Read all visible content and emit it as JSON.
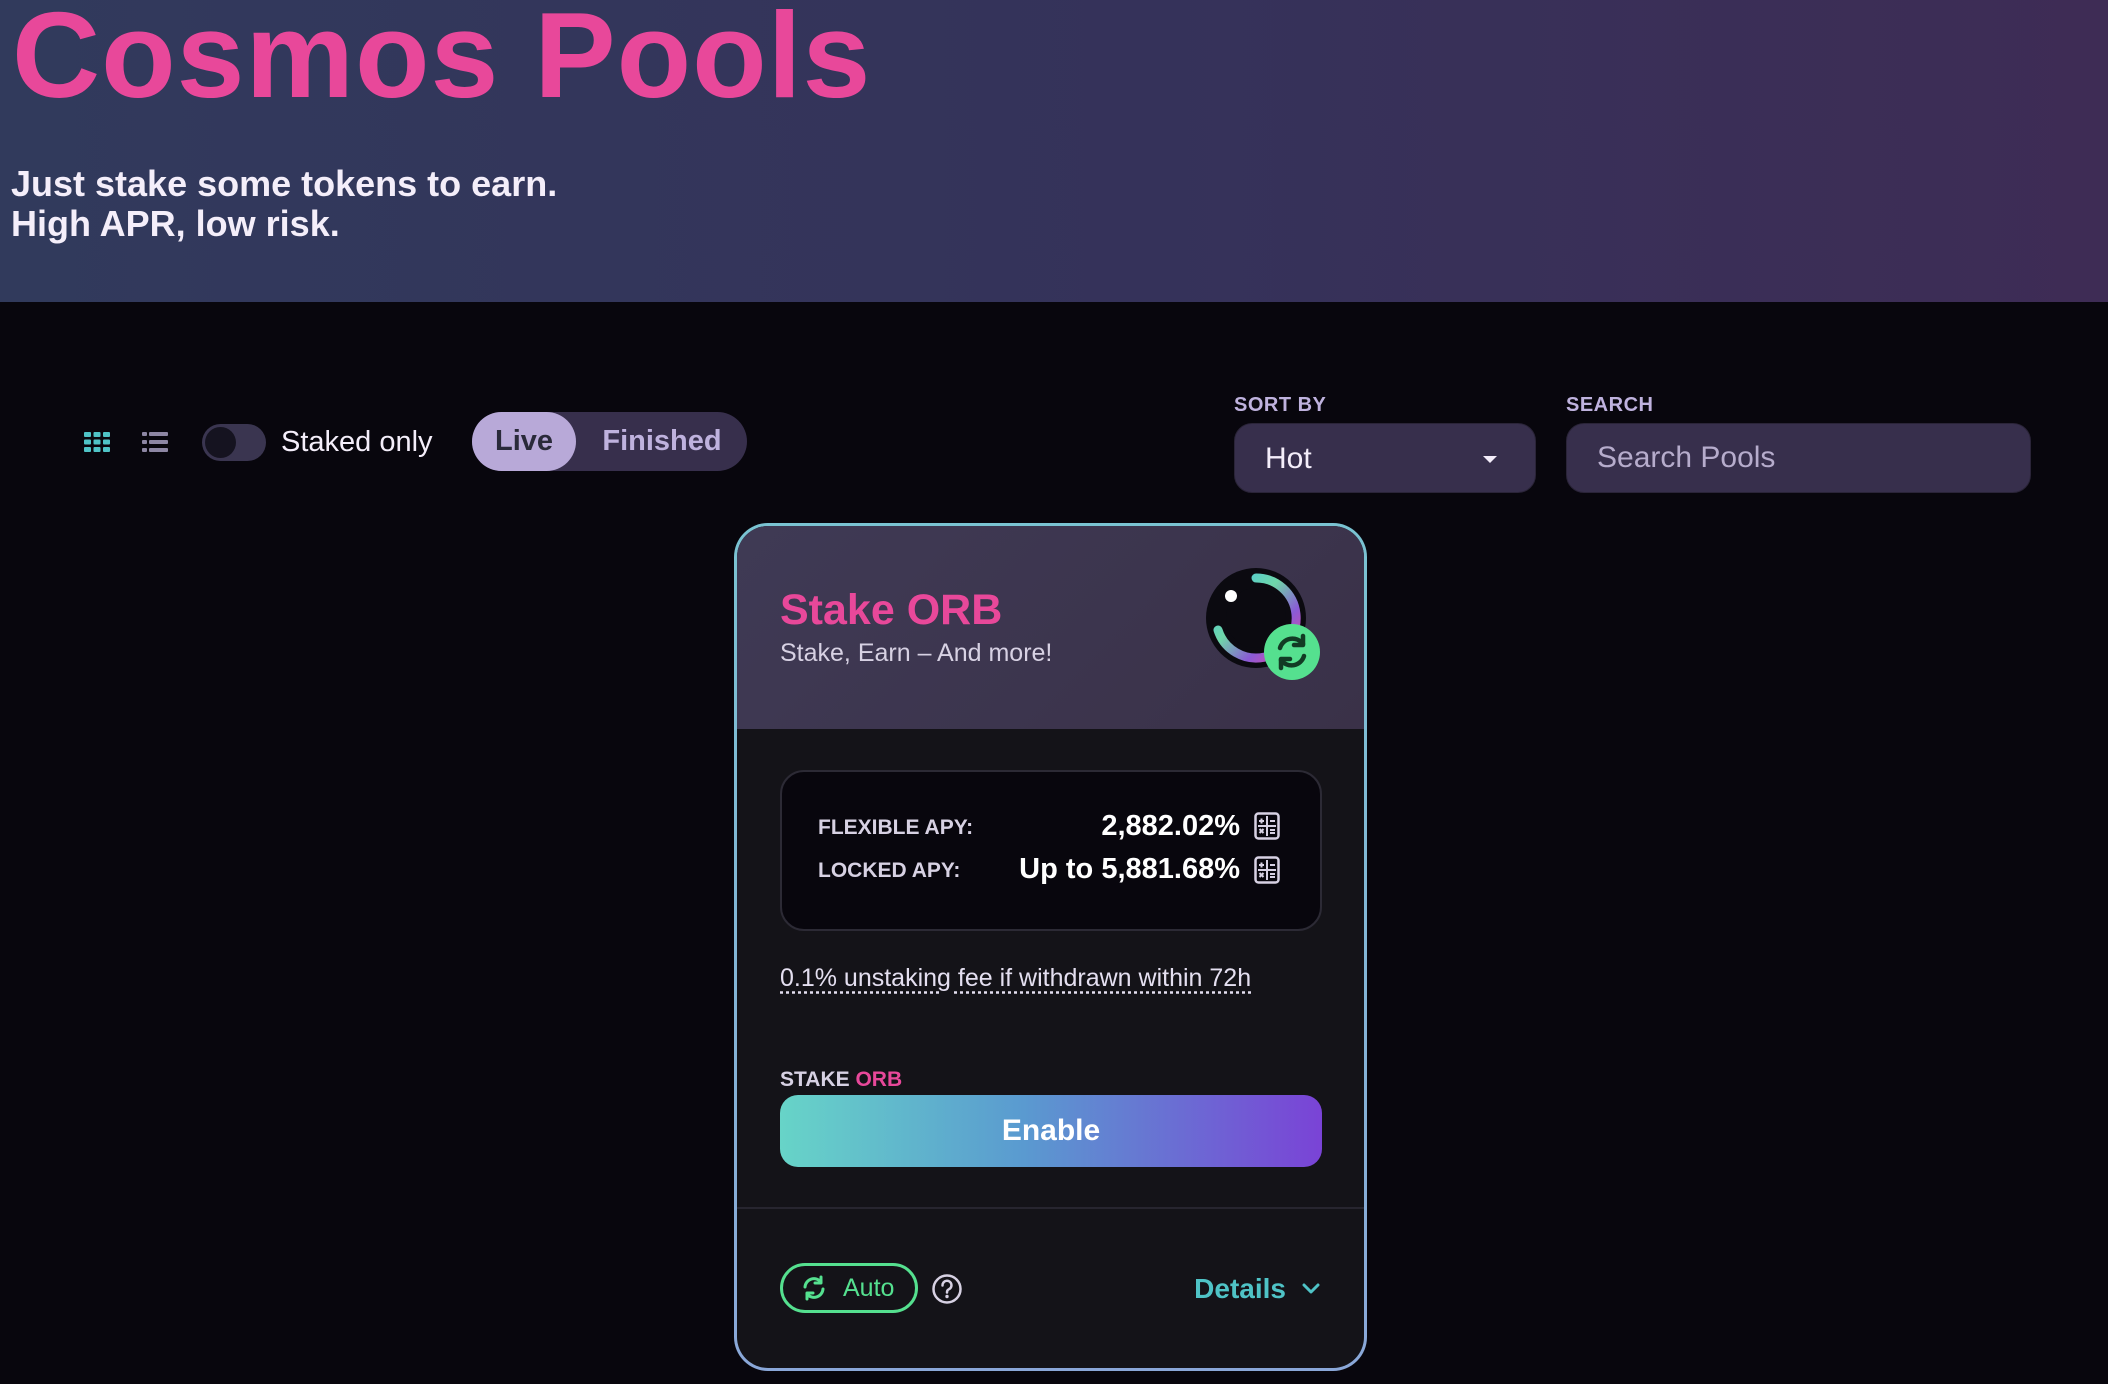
{
  "header": {
    "title": "Cosmos Pools",
    "subtitle_line1": "Just stake some tokens to earn.",
    "subtitle_line2": "High APR, low risk."
  },
  "toolbar": {
    "staked_only_label": "Staked only",
    "staked_only_on": false,
    "tabs": [
      {
        "label": "Live",
        "active": true
      },
      {
        "label": "Finished",
        "active": false
      }
    ],
    "sort_label": "SORT BY",
    "sort_value": "Hot",
    "search_label": "SEARCH",
    "search_placeholder": "Search Pools"
  },
  "pool_card": {
    "title": "Stake ORB",
    "subtitle": "Stake, Earn – And more!",
    "flexible_apy_label": "FLEXIBLE APY:",
    "flexible_apy_value": "2,882.02%",
    "locked_apy_label": "LOCKED APY:",
    "locked_apy_value": "Up to 5,881.68%",
    "fee_note": "0.1% unstaking fee if withdrawn within 72h",
    "stake_label_prefix": "STAKE",
    "stake_token": "ORB",
    "enable_label": "Enable",
    "auto_tag": "Auto",
    "details_label": "Details"
  },
  "colors": {
    "accent_pink": "#e8489a",
    "accent_teal": "#4fc3c6",
    "auto_green": "#55e08f"
  },
  "icons": {
    "grid_view": "grid-view-icon",
    "list_view": "list-view-icon",
    "caret": "caret-down-icon",
    "calculator": "calculator-icon",
    "refresh": "refresh-icon",
    "help": "help-circle-icon",
    "chevron": "chevron-down-icon"
  }
}
